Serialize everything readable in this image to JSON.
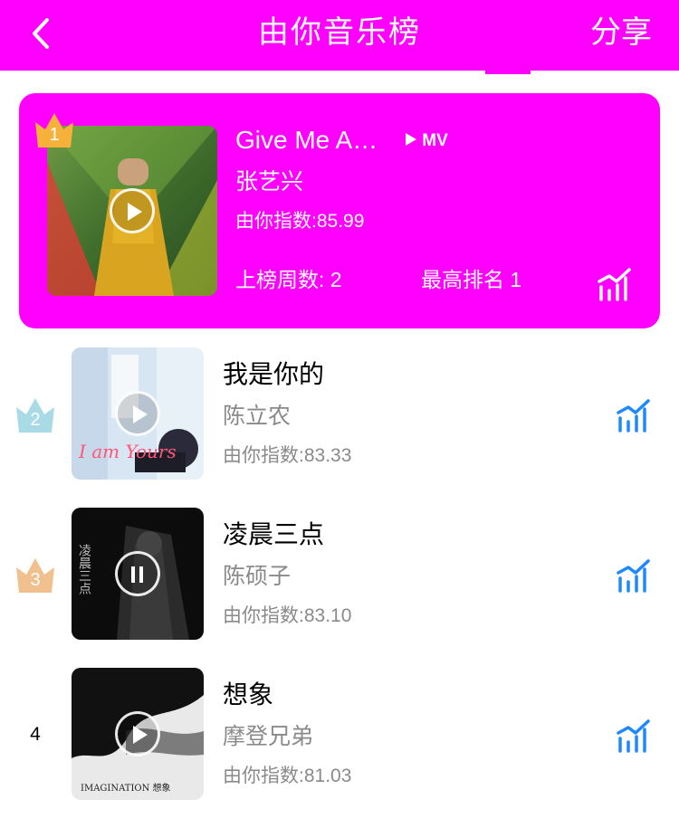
{
  "header": {
    "title": "由你音乐榜",
    "share_label": "分享",
    "background": "#ff00ff"
  },
  "featured": {
    "rank": "1",
    "song": "Give Me A…",
    "mv_label": "MV",
    "artist": "张艺兴",
    "index_text": "由你指数:85.99",
    "weeks_text": "上榜周数: 2",
    "peak_text": "最高排名 1",
    "crown_color": "#f5b13a"
  },
  "list": [
    {
      "rank": "2",
      "song": "我是你的",
      "artist": "陈立农",
      "index_text": "由你指数:83.33",
      "cover_text": "I am Yours",
      "crown_color": "#a8dbe6",
      "play_state": "play"
    },
    {
      "rank": "3",
      "song": "凌晨三点",
      "artist": "陈硕子",
      "index_text": "由你指数:83.10",
      "cover_text": "凌晨三点",
      "crown_color": "#f0c08e",
      "play_state": "pause"
    },
    {
      "rank": "4",
      "song": "想象",
      "artist": "摩登兄弟",
      "index_text": "由你指数:81.03",
      "cover_text": "IMAGINATION 想象",
      "play_state": "play"
    }
  ],
  "icons": {
    "back": "chevron-left-icon",
    "trend": "trend-chart-icon",
    "crown": "crown-icon",
    "play": "play-icon",
    "pause": "pause-icon"
  },
  "colors": {
    "accent": "#ff00ff",
    "trend_blue": "#1e88ff",
    "secondary_text": "#8a8a8a"
  }
}
